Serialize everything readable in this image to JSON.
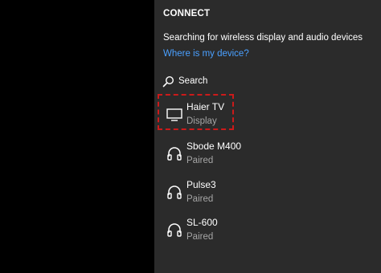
{
  "panel": {
    "title": "CONNECT",
    "status": "Searching for wireless display and audio devices",
    "help_link": "Where is my device?",
    "search_label": "Search"
  },
  "devices": [
    {
      "name": "Haier TV",
      "type": "Display",
      "icon": "monitor-icon"
    },
    {
      "name": "Sbode M400",
      "type": "Paired",
      "icon": "headphones-icon"
    },
    {
      "name": "Pulse3",
      "type": "Paired",
      "icon": "headphones-icon"
    },
    {
      "name": "SL-600",
      "type": "Paired",
      "icon": "headphones-icon"
    }
  ],
  "colors": {
    "panel_bg": "#2b2b2b",
    "link": "#4aa0ff",
    "secondary_text": "#a6a6a6",
    "highlight": "#cc1a1a"
  }
}
